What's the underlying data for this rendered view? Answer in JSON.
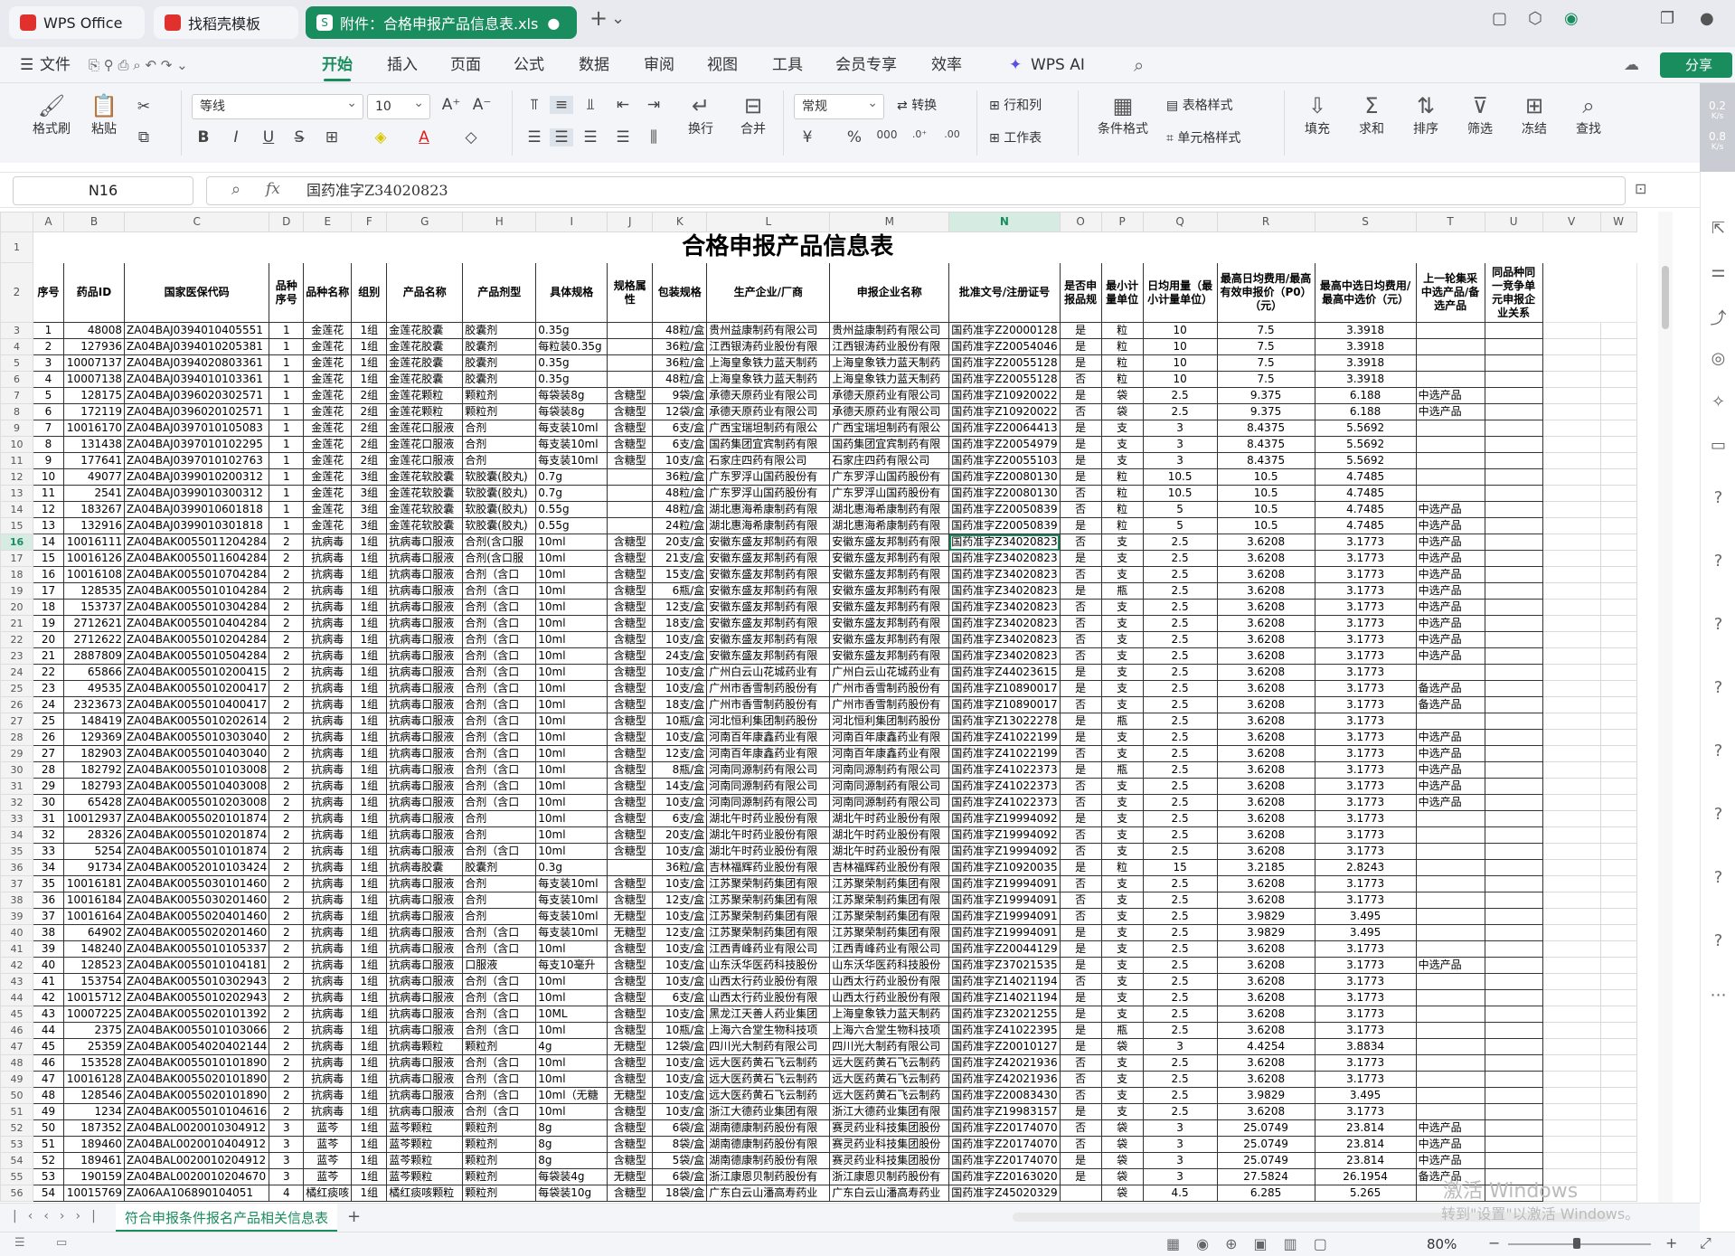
{
  "tabs": [
    {
      "label": "WPS Office"
    },
    {
      "label": "找稻壳模板"
    },
    {
      "label": "附件：合格申报产品信息表.xls"
    }
  ],
  "menu": [
    "文件",
    "开始",
    "插入",
    "页面",
    "公式",
    "数据",
    "审阅",
    "视图",
    "工具",
    "会员专享",
    "效率",
    "WPS AI"
  ],
  "share_label": "分享",
  "ribbon": {
    "format_brush": "格式刷",
    "paste": "粘贴",
    "font": "等线",
    "size": "10",
    "number_format": "常规",
    "convert": "转换",
    "row_col": "行和列",
    "table_style": "表格样式",
    "worksheet": "工作表",
    "cond_format": "条件格式",
    "cell_style": "单元格样式",
    "wrap": "换行",
    "merge": "合并",
    "fill": "填充",
    "sum": "求和",
    "sort": "排序",
    "filter": "筛选",
    "freeze": "冻结",
    "find": "查找"
  },
  "net": {
    "up": "0.2",
    "down": "0.8",
    "unit": "K/s"
  },
  "formula": {
    "cell": "N16",
    "fx": "fx",
    "value": "国药准字Z34020823"
  },
  "columns": [
    "A",
    "B",
    "C",
    "D",
    "E",
    "F",
    "G",
    "H",
    "I",
    "J",
    "K",
    "L",
    "M",
    "N",
    "O",
    "P",
    "Q",
    "R",
    "S",
    "T",
    "U",
    "V",
    "W"
  ],
  "sheet_title": "合格申报产品信息表",
  "headers": [
    "序号",
    "药品ID",
    "国家医保代码",
    "品种序号",
    "品种名称",
    "组别",
    "产品名称",
    "产品剂型",
    "具体规格",
    "规格属性",
    "包装规格",
    "生产企业/厂商",
    "申报企业名称",
    "批准文号/注册证号",
    "是否申报品规",
    "最小计量单位",
    "日均用量（最小计量单位）",
    "最高日均费用/最高有效申报价（P0）（元）",
    "最高中选日均费用/最高中选价（元）",
    "上一轮集采中选产品/备选产品",
    "同品种同一竞争单元申报企业关系"
  ],
  "rows": [
    [
      "1",
      "48008",
      "ZA04BAJ0394010405551",
      "1",
      "金莲花",
      "1组",
      "金莲花胶囊",
      "胶囊剂",
      "0.35g",
      "",
      "48粒/盒",
      "贵州益康制药有限公司",
      "贵州益康制药有限公司",
      "国药准字Z20000128",
      "是",
      "粒",
      "10",
      "7.5",
      "3.3918",
      "",
      ""
    ],
    [
      "2",
      "127936",
      "ZA04BAJ0394010205381",
      "1",
      "金莲花",
      "1组",
      "金莲花胶囊",
      "胶囊剂",
      "每粒装0.35g",
      "",
      "36粒/盒",
      "江西银涛药业股份有限",
      "江西银涛药业股份有限",
      "国药准字Z20054046",
      "是",
      "粒",
      "10",
      "7.5",
      "3.3918",
      "",
      ""
    ],
    [
      "3",
      "10007137",
      "ZA04BAJ0394020803361",
      "1",
      "金莲花",
      "1组",
      "金莲花胶囊",
      "胶囊剂",
      "0.35g",
      "",
      "36粒/盒",
      "上海皇象铁力蓝天制药",
      "上海皇象铁力蓝天制药",
      "国药准字Z20055128",
      "是",
      "粒",
      "10",
      "7.5",
      "3.3918",
      "",
      ""
    ],
    [
      "4",
      "10007138",
      "ZA04BAJ0394010103361",
      "1",
      "金莲花",
      "1组",
      "金莲花胶囊",
      "胶囊剂",
      "0.35g",
      "",
      "48粒/盒",
      "上海皇象铁力蓝天制药",
      "上海皇象铁力蓝天制药",
      "国药准字Z20055128",
      "否",
      "粒",
      "10",
      "7.5",
      "3.3918",
      "",
      ""
    ],
    [
      "5",
      "128175",
      "ZA04BAJ0396020302571",
      "1",
      "金莲花",
      "2组",
      "金莲花颗粒",
      "颗粒剂",
      "每袋装8g",
      "含糖型",
      "9袋/盒",
      "承德天原药业有限公司",
      "承德天原药业有限公司",
      "国药准字Z10920022",
      "是",
      "袋",
      "2.5",
      "9.375",
      "6.188",
      "中选产品",
      ""
    ],
    [
      "6",
      "172119",
      "ZA04BAJ0396020102571",
      "1",
      "金莲花",
      "2组",
      "金莲花颗粒",
      "颗粒剂",
      "每袋装8g",
      "含糖型",
      "12袋/盒",
      "承德天原药业有限公司",
      "承德天原药业有限公司",
      "国药准字Z10920022",
      "否",
      "袋",
      "2.5",
      "9.375",
      "6.188",
      "中选产品",
      ""
    ],
    [
      "7",
      "10016170",
      "ZA04BAJ0397010105083",
      "1",
      "金莲花",
      "2组",
      "金莲花口服液",
      "合剂",
      "每支装10ml",
      "含糖型",
      "6支/盒",
      "广西宝瑞坦制药有限公",
      "广西宝瑞坦制药有限公",
      "国药准字Z20064413",
      "是",
      "支",
      "3",
      "8.4375",
      "5.5692",
      "",
      ""
    ],
    [
      "8",
      "131438",
      "ZA04BAJ0397010102295",
      "1",
      "金莲花",
      "2组",
      "金莲花口服液",
      "合剂",
      "每支装10ml",
      "含糖型",
      "6支/盒",
      "国药集团宜宾制药有限",
      "国药集团宜宾制药有限",
      "国药准字Z20054979",
      "是",
      "支",
      "3",
      "8.4375",
      "5.5692",
      "",
      ""
    ],
    [
      "9",
      "177641",
      "ZA04BAJ0397010102763",
      "1",
      "金莲花",
      "2组",
      "金莲花口服液",
      "合剂",
      "每支装10ml",
      "含糖型",
      "10支/盒",
      "石家庄四药有限公司",
      "石家庄四药有限公司",
      "国药准字Z20055103",
      "是",
      "支",
      "3",
      "8.4375",
      "5.5692",
      "",
      ""
    ],
    [
      "10",
      "49077",
      "ZA04BAJ0399010200312",
      "1",
      "金莲花",
      "3组",
      "金莲花软胶囊",
      "软胶囊(胶丸)",
      "0.7g",
      "",
      "36粒/盒",
      "广东罗浮山国药股份有",
      "广东罗浮山国药股份有",
      "国药准字Z20080130",
      "是",
      "粒",
      "10.5",
      "10.5",
      "4.7485",
      "",
      ""
    ],
    [
      "11",
      "2541",
      "ZA04BAJ0399010300312",
      "1",
      "金莲花",
      "3组",
      "金莲花软胶囊",
      "软胶囊(胶丸)",
      "0.7g",
      "",
      "48粒/盒",
      "广东罗浮山国药股份有",
      "广东罗浮山国药股份有",
      "国药准字Z20080130",
      "否",
      "粒",
      "10.5",
      "10.5",
      "4.7485",
      "",
      ""
    ],
    [
      "12",
      "183267",
      "ZA04BAJ0399010601818",
      "1",
      "金莲花",
      "3组",
      "金莲花软胶囊",
      "软胶囊(胶丸)",
      "0.55g",
      "",
      "48粒/盒",
      "湖北惠海希康制药有限",
      "湖北惠海希康制药有限",
      "国药准字Z20050839",
      "否",
      "粒",
      "5",
      "10.5",
      "4.7485",
      "中选产品",
      ""
    ],
    [
      "13",
      "132916",
      "ZA04BAJ0399010301818",
      "1",
      "金莲花",
      "3组",
      "金莲花软胶囊",
      "软胶囊(胶丸)",
      "0.55g",
      "",
      "24粒/盒",
      "湖北惠海希康制药有限",
      "湖北惠海希康制药有限",
      "国药准字Z20050839",
      "是",
      "粒",
      "5",
      "10.5",
      "4.7485",
      "中选产品",
      ""
    ],
    [
      "14",
      "10016111",
      "ZA04BAK0055011204284",
      "2",
      "抗病毒",
      "1组",
      "抗病毒口服液",
      "合剂(含口服",
      "10ml",
      "含糖型",
      "20支/盒",
      "安徽东盛友邦制药有限",
      "安徽东盛友邦制药有限",
      "国药准字Z34020823",
      "否",
      "支",
      "2.5",
      "3.6208",
      "3.1773",
      "中选产品",
      ""
    ],
    [
      "15",
      "10016126",
      "ZA04BAK0055011604284",
      "2",
      "抗病毒",
      "1组",
      "抗病毒口服液",
      "合剂(含口服",
      "10ml",
      "含糖型",
      "21支/盒",
      "安徽东盛友邦制药有限",
      "安徽东盛友邦制药有限",
      "国药准字Z34020823",
      "是",
      "支",
      "2.5",
      "3.6208",
      "3.1773",
      "中选产品",
      ""
    ],
    [
      "16",
      "10016108",
      "ZA04BAK0055010704284",
      "2",
      "抗病毒",
      "1组",
      "抗病毒口服液",
      "合剂（含口",
      "10ml",
      "含糖型",
      "15支/盒",
      "安徽东盛友邦制药有限",
      "安徽东盛友邦制药有限",
      "国药准字Z34020823",
      "否",
      "支",
      "2.5",
      "3.6208",
      "3.1773",
      "中选产品",
      ""
    ],
    [
      "17",
      "128535",
      "ZA04BAK0055010104284",
      "2",
      "抗病毒",
      "1组",
      "抗病毒口服液",
      "合剂（含口",
      "10ml",
      "含糖型",
      "6瓶/盒",
      "安徽东盛友邦制药有限",
      "安徽东盛友邦制药有限",
      "国药准字Z34020823",
      "是",
      "瓶",
      "2.5",
      "3.6208",
      "3.1773",
      "中选产品",
      ""
    ],
    [
      "18",
      "153737",
      "ZA04BAK0055010304284",
      "2",
      "抗病毒",
      "1组",
      "抗病毒口服液",
      "合剂（含口",
      "10ml",
      "含糖型",
      "12支/盒",
      "安徽东盛友邦制药有限",
      "安徽东盛友邦制药有限",
      "国药准字Z34020823",
      "否",
      "支",
      "2.5",
      "3.6208",
      "3.1773",
      "中选产品",
      ""
    ],
    [
      "19",
      "2712621",
      "ZA04BAK0055010404284",
      "2",
      "抗病毒",
      "1组",
      "抗病毒口服液",
      "合剂（含口",
      "10ml",
      "含糖型",
      "18支/盒",
      "安徽东盛友邦制药有限",
      "安徽东盛友邦制药有限",
      "国药准字Z34020823",
      "否",
      "支",
      "2.5",
      "3.6208",
      "3.1773",
      "中选产品",
      ""
    ],
    [
      "20",
      "2712622",
      "ZA04BAK0055010204284",
      "2",
      "抗病毒",
      "1组",
      "抗病毒口服液",
      "合剂（含口",
      "10ml",
      "含糖型",
      "10支/盒",
      "安徽东盛友邦制药有限",
      "安徽东盛友邦制药有限",
      "国药准字Z34020823",
      "否",
      "支",
      "2.5",
      "3.6208",
      "3.1773",
      "中选产品",
      ""
    ],
    [
      "21",
      "2887809",
      "ZA04BAK0055010504284",
      "2",
      "抗病毒",
      "1组",
      "抗病毒口服液",
      "合剂（含口",
      "10ml",
      "含糖型",
      "24支/盒",
      "安徽东盛友邦制药有限",
      "安徽东盛友邦制药有限",
      "国药准字Z34020823",
      "否",
      "支",
      "2.5",
      "3.6208",
      "3.1773",
      "中选产品",
      ""
    ],
    [
      "22",
      "65866",
      "ZA04BAK0055010200415",
      "2",
      "抗病毒",
      "1组",
      "抗病毒口服液",
      "合剂（含口",
      "10ml",
      "含糖型",
      "10支/盒",
      "广州白云山花城药业有",
      "广州白云山花城药业有",
      "国药准字Z44023615",
      "是",
      "支",
      "2.5",
      "3.6208",
      "3.1773",
      "",
      ""
    ],
    [
      "23",
      "49535",
      "ZA04BAK0055010200417",
      "2",
      "抗病毒",
      "1组",
      "抗病毒口服液",
      "合剂（含口",
      "10ml",
      "含糖型",
      "10支/盒",
      "广州市香雪制药股份有",
      "广州市香雪制药股份有",
      "国药准字Z10890017",
      "是",
      "支",
      "2.5",
      "3.6208",
      "3.1773",
      "备选产品",
      ""
    ],
    [
      "24",
      "2323673",
      "ZA04BAK0055010400417",
      "2",
      "抗病毒",
      "1组",
      "抗病毒口服液",
      "合剂（含口",
      "10ml",
      "含糖型",
      "18支/盒",
      "广州市香雪制药股份有",
      "广州市香雪制药股份有",
      "国药准字Z10890017",
      "否",
      "支",
      "2.5",
      "3.6208",
      "3.1773",
      "备选产品",
      ""
    ],
    [
      "25",
      "148419",
      "ZA04BAK0055010202614",
      "2",
      "抗病毒",
      "1组",
      "抗病毒口服液",
      "合剂（含口",
      "10ml",
      "含糖型",
      "10瓶/盒",
      "河北恒利集团制药股份",
      "河北恒利集团制药股份",
      "国药准字Z13022278",
      "是",
      "瓶",
      "2.5",
      "3.6208",
      "3.1773",
      "",
      ""
    ],
    [
      "26",
      "129369",
      "ZA04BAK0055010303040",
      "2",
      "抗病毒",
      "1组",
      "抗病毒口服液",
      "合剂（含口",
      "10ml",
      "含糖型",
      "10支/盒",
      "河南百年康鑫药业有限",
      "河南百年康鑫药业有限",
      "国药准字Z41022199",
      "是",
      "支",
      "2.5",
      "3.6208",
      "3.1773",
      "中选产品",
      ""
    ],
    [
      "27",
      "182903",
      "ZA04BAK0055010403040",
      "2",
      "抗病毒",
      "1组",
      "抗病毒口服液",
      "合剂（含口",
      "10ml",
      "含糖型",
      "12支/盒",
      "河南百年康鑫药业有限",
      "河南百年康鑫药业有限",
      "国药准字Z41022199",
      "否",
      "支",
      "2.5",
      "3.6208",
      "3.1773",
      "中选产品",
      ""
    ],
    [
      "28",
      "182792",
      "ZA04BAK0055010103008",
      "2",
      "抗病毒",
      "1组",
      "抗病毒口服液",
      "合剂（含口",
      "10ml",
      "含糖型",
      "8瓶/盒",
      "河南同源制药有限公司",
      "河南同源制药有限公司",
      "国药准字Z41022373",
      "是",
      "瓶",
      "2.5",
      "3.6208",
      "3.1773",
      "中选产品",
      ""
    ],
    [
      "29",
      "182793",
      "ZA04BAK0055010403008",
      "2",
      "抗病毒",
      "1组",
      "抗病毒口服液",
      "合剂（含口",
      "10ml",
      "含糖型",
      "14支/盒",
      "河南同源制药有限公司",
      "河南同源制药有限公司",
      "国药准字Z41022373",
      "否",
      "支",
      "2.5",
      "3.6208",
      "3.1773",
      "中选产品",
      ""
    ],
    [
      "30",
      "65428",
      "ZA04BAK0055010203008",
      "2",
      "抗病毒",
      "1组",
      "抗病毒口服液",
      "合剂（含口",
      "10ml",
      "含糖型",
      "10支/盒",
      "河南同源制药有限公司",
      "河南同源制药有限公司",
      "国药准字Z41022373",
      "否",
      "支",
      "2.5",
      "3.6208",
      "3.1773",
      "中选产品",
      ""
    ],
    [
      "31",
      "10012937",
      "ZA04BAK0055020101874",
      "2",
      "抗病毒",
      "1组",
      "抗病毒口服液",
      "合剂",
      "10ml",
      "含糖型",
      "6支/盒",
      "湖北午时药业股份有限",
      "湖北午时药业股份有限",
      "国药准字Z19994092",
      "是",
      "支",
      "2.5",
      "3.6208",
      "3.1773",
      "",
      ""
    ],
    [
      "32",
      "28326",
      "ZA04BAK0055010201874",
      "2",
      "抗病毒",
      "1组",
      "抗病毒口服液",
      "合剂",
      "10ml",
      "含糖型",
      "20支/盒",
      "湖北午时药业股份有限",
      "湖北午时药业股份有限",
      "国药准字Z19994092",
      "否",
      "支",
      "2.5",
      "3.6208",
      "3.1773",
      "",
      ""
    ],
    [
      "33",
      "5254",
      "ZA04BAK0055010101874",
      "2",
      "抗病毒",
      "1组",
      "抗病毒口服液",
      "合剂（含口",
      "10ml",
      "含糖型",
      "10支/盒",
      "湖北午时药业股份有限",
      "湖北午时药业股份有限",
      "国药准字Z19994092",
      "否",
      "支",
      "2.5",
      "3.6208",
      "3.1773",
      "",
      ""
    ],
    [
      "34",
      "91734",
      "ZA04BAK0052010103424",
      "2",
      "抗病毒",
      "1组",
      "抗病毒胶囊",
      "胶囊剂",
      "0.3g",
      "",
      "36粒/盒",
      "吉林福辉药业股份有限",
      "吉林福辉药业股份有限",
      "国药准字Z10920035",
      "是",
      "粒",
      "15",
      "3.2185",
      "2.8243",
      "",
      ""
    ],
    [
      "35",
      "10016181",
      "ZA04BAK0055030101460",
      "2",
      "抗病毒",
      "1组",
      "抗病毒口服液",
      "合剂",
      "每支装10ml",
      "含糖型",
      "10支/盒",
      "江苏聚荣制药集团有限",
      "江苏聚荣制药集团有限",
      "国药准字Z19994091",
      "否",
      "支",
      "2.5",
      "3.6208",
      "3.1773",
      "",
      ""
    ],
    [
      "36",
      "10016184",
      "ZA04BAK0055030201460",
      "2",
      "抗病毒",
      "1组",
      "抗病毒口服液",
      "合剂",
      "每支装10ml",
      "含糖型",
      "12支/盒",
      "江苏聚荣制药集团有限",
      "江苏聚荣制药集团有限",
      "国药准字Z19994091",
      "否",
      "支",
      "2.5",
      "3.6208",
      "3.1773",
      "",
      ""
    ],
    [
      "37",
      "10016164",
      "ZA04BAK0055020401460",
      "2",
      "抗病毒",
      "1组",
      "抗病毒口服液",
      "合剂",
      "每支装10ml",
      "无糖型",
      "10支/盒",
      "江苏聚荣制药集团有限",
      "江苏聚荣制药集团有限",
      "国药准字Z19994091",
      "否",
      "支",
      "2.5",
      "3.9829",
      "3.495",
      "",
      ""
    ],
    [
      "38",
      "64902",
      "ZA04BAK0055020201460",
      "2",
      "抗病毒",
      "1组",
      "抗病毒口服液",
      "合剂（含口",
      "每支装10ml",
      "无糖型",
      "12支/盒",
      "江苏聚荣制药集团有限",
      "江苏聚荣制药集团有限",
      "国药准字Z19994091",
      "是",
      "支",
      "2.5",
      "3.9829",
      "3.495",
      "",
      ""
    ],
    [
      "39",
      "148240",
      "ZA04BAK0055010105337",
      "2",
      "抗病毒",
      "1组",
      "抗病毒口服液",
      "合剂（含口",
      "10ml",
      "含糖型",
      "10支/盒",
      "江西青峰药业有限公司",
      "江西青峰药业有限公司",
      "国药准字Z20044129",
      "是",
      "支",
      "2.5",
      "3.6208",
      "3.1773",
      "",
      ""
    ],
    [
      "40",
      "128523",
      "ZA04BAK0055010104181",
      "2",
      "抗病毒",
      "1组",
      "抗病毒口服液",
      "口服液",
      "每支10毫升",
      "含糖型",
      "10支/盒",
      "山东沃华医药科技股份",
      "山东沃华医药科技股份",
      "国药准字Z37021535",
      "是",
      "支",
      "2.5",
      "3.6208",
      "3.1773",
      "中选产品",
      ""
    ],
    [
      "41",
      "153754",
      "ZA04BAK0055010302943",
      "2",
      "抗病毒",
      "1组",
      "抗病毒口服液",
      "合剂（含口",
      "10ml",
      "含糖型",
      "10支/盒",
      "山西太行药业股份有限",
      "山西太行药业股份有限",
      "国药准字Z14021194",
      "否",
      "支",
      "2.5",
      "3.6208",
      "3.1773",
      "",
      ""
    ],
    [
      "42",
      "10015712",
      "ZA04BAK0055010202943",
      "2",
      "抗病毒",
      "1组",
      "抗病毒口服液",
      "合剂（含口",
      "10ml",
      "含糖型",
      "6支/盒",
      "山西太行药业股份有限",
      "山西太行药业股份有限",
      "国药准字Z14021194",
      "是",
      "支",
      "2.5",
      "3.6208",
      "3.1773",
      "",
      ""
    ],
    [
      "43",
      "10007225",
      "ZA04BAK0055020101392",
      "2",
      "抗病毒",
      "1组",
      "抗病毒口服液",
      "合剂（含口",
      "10ML",
      "含糖型",
      "10支/盒",
      "黑龙江天善人药业集团",
      "上海皇象铁力蓝天制药",
      "国药准字Z32021255",
      "是",
      "支",
      "2.5",
      "3.6208",
      "3.1773",
      "",
      ""
    ],
    [
      "44",
      "2375",
      "ZA04BAK0055010103066",
      "2",
      "抗病毒",
      "1组",
      "抗病毒口服液",
      "合剂（含口",
      "10ml",
      "含糖型",
      "10瓶/盒",
      "上海六合堂生物科技项",
      "上海六合堂生物科技项",
      "国药准字Z41022395",
      "是",
      "瓶",
      "2.5",
      "3.6208",
      "3.1773",
      "",
      ""
    ],
    [
      "45",
      "25359",
      "ZA04BAK0054020402144",
      "2",
      "抗病毒",
      "1组",
      "抗病毒颗粒",
      "颗粒剂",
      "4g",
      "无糖型",
      "12袋/盒",
      "四川光大制药有限公司",
      "四川光大制药有限公司",
      "国药准字Z20010127",
      "是",
      "袋",
      "3",
      "4.4254",
      "3.8834",
      "",
      ""
    ],
    [
      "46",
      "153528",
      "ZA04BAK0055010101890",
      "2",
      "抗病毒",
      "1组",
      "抗病毒口服液",
      "合剂（含口",
      "10ml",
      "含糖型",
      "10支/盒",
      "远大医药黄石飞云制药",
      "远大医药黄石飞云制药",
      "国药准字Z42021936",
      "否",
      "支",
      "2.5",
      "3.6208",
      "3.1773",
      "",
      ""
    ],
    [
      "47",
      "10016128",
      "ZA04BAK0055020101890",
      "2",
      "抗病毒",
      "1组",
      "抗病毒口服液",
      "合剂（含口",
      "10ml",
      "含糖型",
      "10支/盒",
      "远大医药黄石飞云制药",
      "远大医药黄石飞云制药",
      "国药准字Z42021936",
      "否",
      "支",
      "2.5",
      "3.6208",
      "3.1773",
      "",
      ""
    ],
    [
      "48",
      "128546",
      "ZA04BAK0055020101890",
      "2",
      "抗病毒",
      "1组",
      "抗病毒口服液",
      "合剂（含口",
      "10ml（无糖",
      "无糖型",
      "10支/盒",
      "远大医药黄石飞云制药",
      "远大医药黄石飞云制药",
      "国药准字Z20083430",
      "否",
      "支",
      "2.5",
      "3.9829",
      "3.495",
      "",
      ""
    ],
    [
      "49",
      "1234",
      "ZA04BAK0055010104616",
      "2",
      "抗病毒",
      "1组",
      "抗病毒口服液",
      "合剂（含口",
      "10ml",
      "含糖型",
      "10支/盒",
      "浙江大德药业集团有限",
      "浙江大德药业集团有限",
      "国药准字Z19983157",
      "是",
      "支",
      "2.5",
      "3.6208",
      "3.1773",
      "",
      ""
    ],
    [
      "50",
      "187352",
      "ZA04BAL0020010304912",
      "3",
      "蓝芩",
      "1组",
      "蓝芩颗粒",
      "颗粒剂",
      "8g",
      "含糖型",
      "6袋/盒",
      "湖南德康制药股份有限",
      "赛灵药业科技集团股份",
      "国药准字Z20174070",
      "否",
      "袋",
      "3",
      "25.0749",
      "23.814",
      "中选产品",
      ""
    ],
    [
      "51",
      "189460",
      "ZA04BAL0020010404912",
      "3",
      "蓝芩",
      "1组",
      "蓝芩颗粒",
      "颗粒剂",
      "8g",
      "含糖型",
      "8袋/盒",
      "湖南德康制药股份有限",
      "赛灵药业科技集团股份",
      "国药准字Z20174070",
      "否",
      "袋",
      "3",
      "25.0749",
      "23.814",
      "中选产品",
      ""
    ],
    [
      "52",
      "189461",
      "ZA04BAL0020010204912",
      "3",
      "蓝芩",
      "1组",
      "蓝芩颗粒",
      "颗粒剂",
      "8g",
      "含糖型",
      "5袋/盒",
      "湖南德康制药股份有限",
      "赛灵药业科技集团股份",
      "国药准字Z20174070",
      "是",
      "袋",
      "3",
      "25.0749",
      "23.814",
      "中选产品",
      ""
    ],
    [
      "53",
      "190159",
      "ZA04BAL0020010204670",
      "3",
      "蓝芩",
      "1组",
      "蓝芩颗粒",
      "颗粒剂",
      "每袋装4g",
      "无糖型",
      "6袋/盒",
      "浙江康恩贝制药股份有",
      "浙江康恩贝制药股份有",
      "国药准字Z20163020",
      "是",
      "袋",
      "3",
      "27.5824",
      "26.1954",
      "备选产品",
      ""
    ],
    [
      "54",
      "10015769",
      "ZA06AA106890104051",
      "4",
      "橘红痰咳",
      "1组",
      "橘红痰咳颗粒",
      "颗粒剂",
      "每袋装10g",
      "含糖型",
      "18袋/盒",
      "广东白云山潘高寿药业",
      "广东白云山潘高寿药业",
      "国药准字Z45020329",
      "",
      "袋",
      "4.5",
      "6.285",
      "5.265",
      "",
      ""
    ]
  ],
  "sheet_tab": "符合申报条件报名产品相关信息表",
  "status": {
    "zoom": "80%"
  },
  "watermark": {
    "line1": "激活 Windows",
    "line2": "转到\"设置\"以激活 Windows。"
  }
}
